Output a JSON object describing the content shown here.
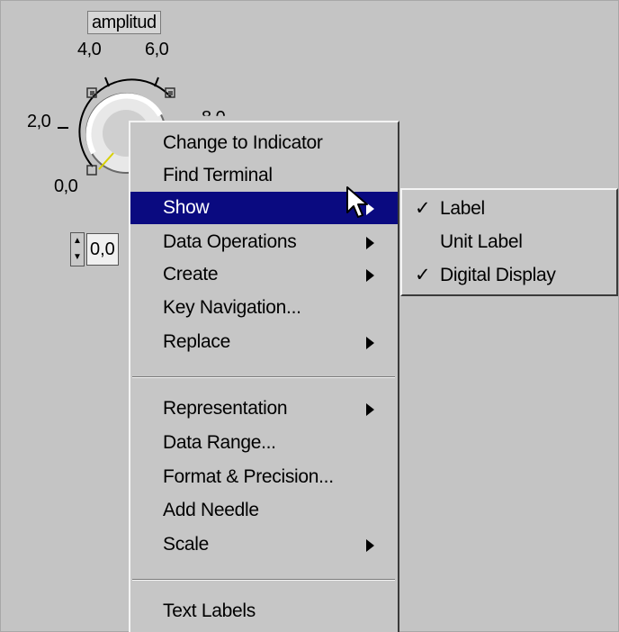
{
  "knob": {
    "label": "amplitud",
    "scale_labels": [
      "0,0",
      "2,0",
      "4,0",
      "6,0",
      "8,0"
    ],
    "digital_value": "0,0"
  },
  "menu": {
    "items": [
      {
        "label": "Change to Indicator",
        "submenu": false
      },
      {
        "label": "Find Terminal",
        "submenu": false
      },
      {
        "label": "Show",
        "submenu": true,
        "highlighted": true
      },
      {
        "label": "Data Operations",
        "submenu": true
      },
      {
        "label": "Create",
        "submenu": true
      },
      {
        "label": "Key Navigation...",
        "submenu": false
      },
      {
        "label": "Replace",
        "submenu": true
      },
      {
        "label": "Representation",
        "submenu": true
      },
      {
        "label": "Data Range...",
        "submenu": false
      },
      {
        "label": "Format & Precision...",
        "submenu": false
      },
      {
        "label": "Add Needle",
        "submenu": false
      },
      {
        "label": "Scale",
        "submenu": true
      },
      {
        "label": "Text Labels",
        "submenu": false
      }
    ]
  },
  "submenu": {
    "items": [
      {
        "label": "Label",
        "checked": true
      },
      {
        "label": "Unit Label",
        "checked": false
      },
      {
        "label": "Digital Display",
        "checked": true
      }
    ],
    "check_glyph": "✓"
  },
  "colors": {
    "background": "#c4c4c4",
    "menu_background": "#c6c6c6",
    "highlight": "#0a0a80"
  }
}
